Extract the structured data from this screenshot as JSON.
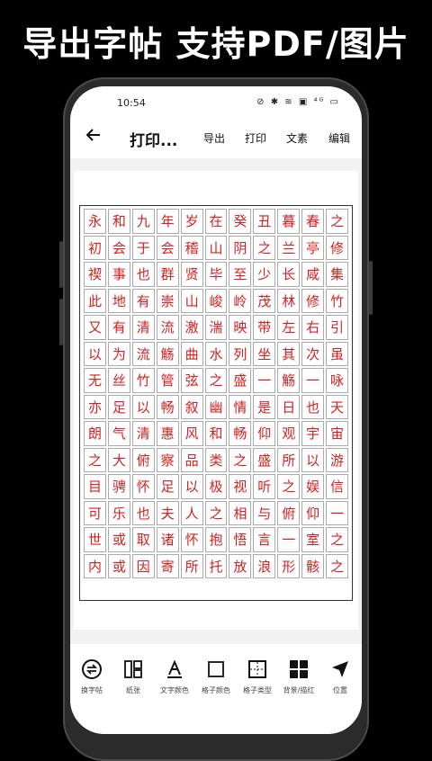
{
  "headline": "导出字帖 支持PDF/图片",
  "status_bar": {
    "time": "10:54",
    "icons": "⊘ ✱ ≋ ▣ ⁴ᴳ ▭"
  },
  "toolbar": {
    "back_icon": "arrow-left",
    "title": "打印...",
    "actions": [
      "导出",
      "打印",
      "文素",
      "编辑"
    ]
  },
  "grid": {
    "rows": [
      [
        "永",
        "和",
        "九",
        "年",
        "岁",
        "在",
        "癸",
        "丑",
        "暮",
        "春",
        "之"
      ],
      [
        "初",
        "会",
        "于",
        "会",
        "稽",
        "山",
        "阴",
        "之",
        "兰",
        "亭",
        "修"
      ],
      [
        "禊",
        "事",
        "也",
        "群",
        "贤",
        "毕",
        "至",
        "少",
        "长",
        "咸",
        "集"
      ],
      [
        "此",
        "地",
        "有",
        "崇",
        "山",
        "峻",
        "岭",
        "茂",
        "林",
        "修",
        "竹"
      ],
      [
        "又",
        "有",
        "清",
        "流",
        "激",
        "湍",
        "映",
        "带",
        "左",
        "右",
        "引"
      ],
      [
        "以",
        "为",
        "流",
        "觞",
        "曲",
        "水",
        "列",
        "坐",
        "其",
        "次",
        "虽"
      ],
      [
        "无",
        "丝",
        "竹",
        "管",
        "弦",
        "之",
        "盛",
        "一",
        "觞",
        "一",
        "咏"
      ],
      [
        "亦",
        "足",
        "以",
        "畅",
        "叙",
        "幽",
        "情",
        "是",
        "日",
        "也",
        "天"
      ],
      [
        "朗",
        "气",
        "清",
        "惠",
        "风",
        "和",
        "畅",
        "仰",
        "观",
        "宇",
        "宙"
      ],
      [
        "之",
        "大",
        "俯",
        "察",
        "品",
        "类",
        "之",
        "盛",
        "所",
        "以",
        "游"
      ],
      [
        "目",
        "骋",
        "怀",
        "足",
        "以",
        "极",
        "视",
        "听",
        "之",
        "娱",
        "信"
      ],
      [
        "可",
        "乐",
        "也",
        "夫",
        "人",
        "之",
        "相",
        "与",
        "俯",
        "仰",
        "一"
      ],
      [
        "世",
        "或",
        "取",
        "诸",
        "怀",
        "抱",
        "悟",
        "言",
        "一",
        "室",
        "之"
      ],
      [
        "内",
        "或",
        "因",
        "寄",
        "所",
        "托",
        "放",
        "浪",
        "形",
        "骸",
        "之"
      ]
    ],
    "char_color": "#d81e1e"
  },
  "bottom_tools": [
    {
      "label": "换字帖",
      "icon": "swap-icon"
    },
    {
      "label": "纸张",
      "icon": "paper-icon"
    },
    {
      "label": "文字颜色",
      "icon": "text-color-icon"
    },
    {
      "label": "格子颜色",
      "icon": "grid-color-icon"
    },
    {
      "label": "格子类型",
      "icon": "grid-type-icon"
    },
    {
      "label": "背景/描红",
      "icon": "background-icon"
    },
    {
      "label": "位置",
      "icon": "position-icon"
    }
  ]
}
